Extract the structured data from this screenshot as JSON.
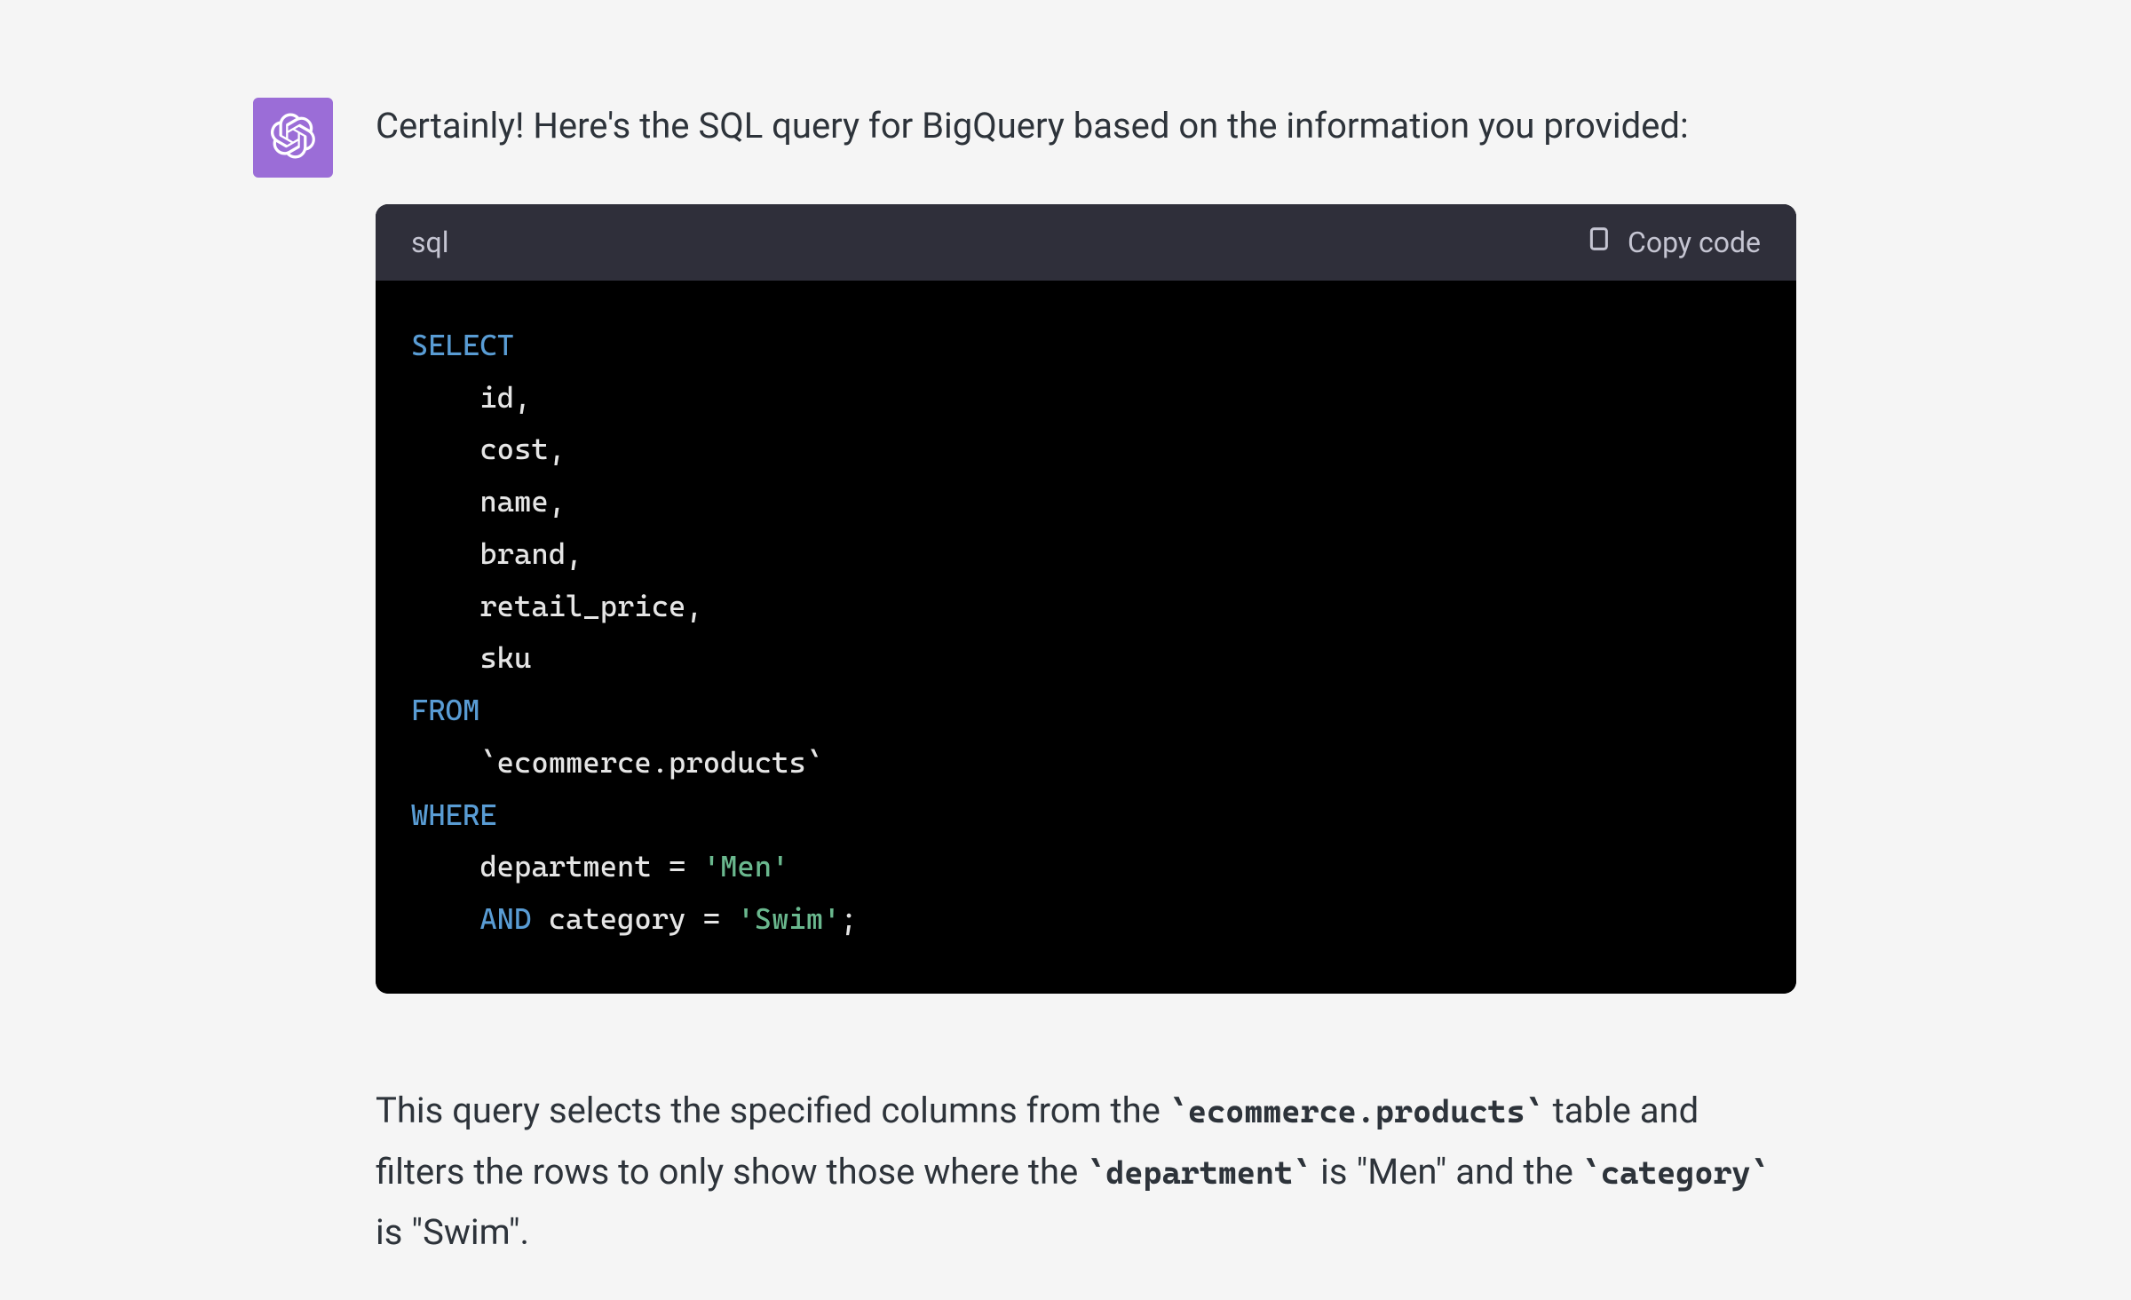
{
  "message": {
    "intro": "Certainly! Here's the SQL query for BigQuery based on the information you provided:",
    "code_block": {
      "language": "sql",
      "copy_label": "Copy code",
      "lines": [
        {
          "tokens": [
            {
              "t": "SELECT",
              "c": "kw"
            }
          ]
        },
        {
          "tokens": [
            {
              "t": "    id,",
              "c": ""
            }
          ]
        },
        {
          "tokens": [
            {
              "t": "    cost,",
              "c": ""
            }
          ]
        },
        {
          "tokens": [
            {
              "t": "    name,",
              "c": ""
            }
          ]
        },
        {
          "tokens": [
            {
              "t": "    brand,",
              "c": ""
            }
          ]
        },
        {
          "tokens": [
            {
              "t": "    retail_price,",
              "c": ""
            }
          ]
        },
        {
          "tokens": [
            {
              "t": "    sku",
              "c": ""
            }
          ]
        },
        {
          "tokens": [
            {
              "t": "FROM",
              "c": "kw"
            }
          ]
        },
        {
          "tokens": [
            {
              "t": "    `ecommerce.products`",
              "c": ""
            }
          ]
        },
        {
          "tokens": [
            {
              "t": "WHERE",
              "c": "kw"
            }
          ]
        },
        {
          "tokens": [
            {
              "t": "    department ",
              "c": ""
            },
            {
              "t": "=",
              "c": ""
            },
            {
              "t": " ",
              "c": ""
            },
            {
              "t": "'Men'",
              "c": "str"
            }
          ]
        },
        {
          "tokens": [
            {
              "t": "    ",
              "c": ""
            },
            {
              "t": "AND",
              "c": "kw"
            },
            {
              "t": " category ",
              "c": ""
            },
            {
              "t": "=",
              "c": ""
            },
            {
              "t": " ",
              "c": ""
            },
            {
              "t": "'Swim'",
              "c": "str"
            },
            {
              "t": ";",
              "c": ""
            }
          ]
        }
      ]
    },
    "explanation": {
      "parts": [
        {
          "t": "This query selects the specified columns from the ",
          "code": false
        },
        {
          "t": "`ecommerce.products`",
          "code": true
        },
        {
          "t": " table and filters the rows to only show those where the ",
          "code": false
        },
        {
          "t": "`department`",
          "code": true
        },
        {
          "t": " is \"Men\" and the ",
          "code": false
        },
        {
          "t": "`category`",
          "code": true
        },
        {
          "t": " is \"Swim\".",
          "code": false
        }
      ]
    }
  }
}
